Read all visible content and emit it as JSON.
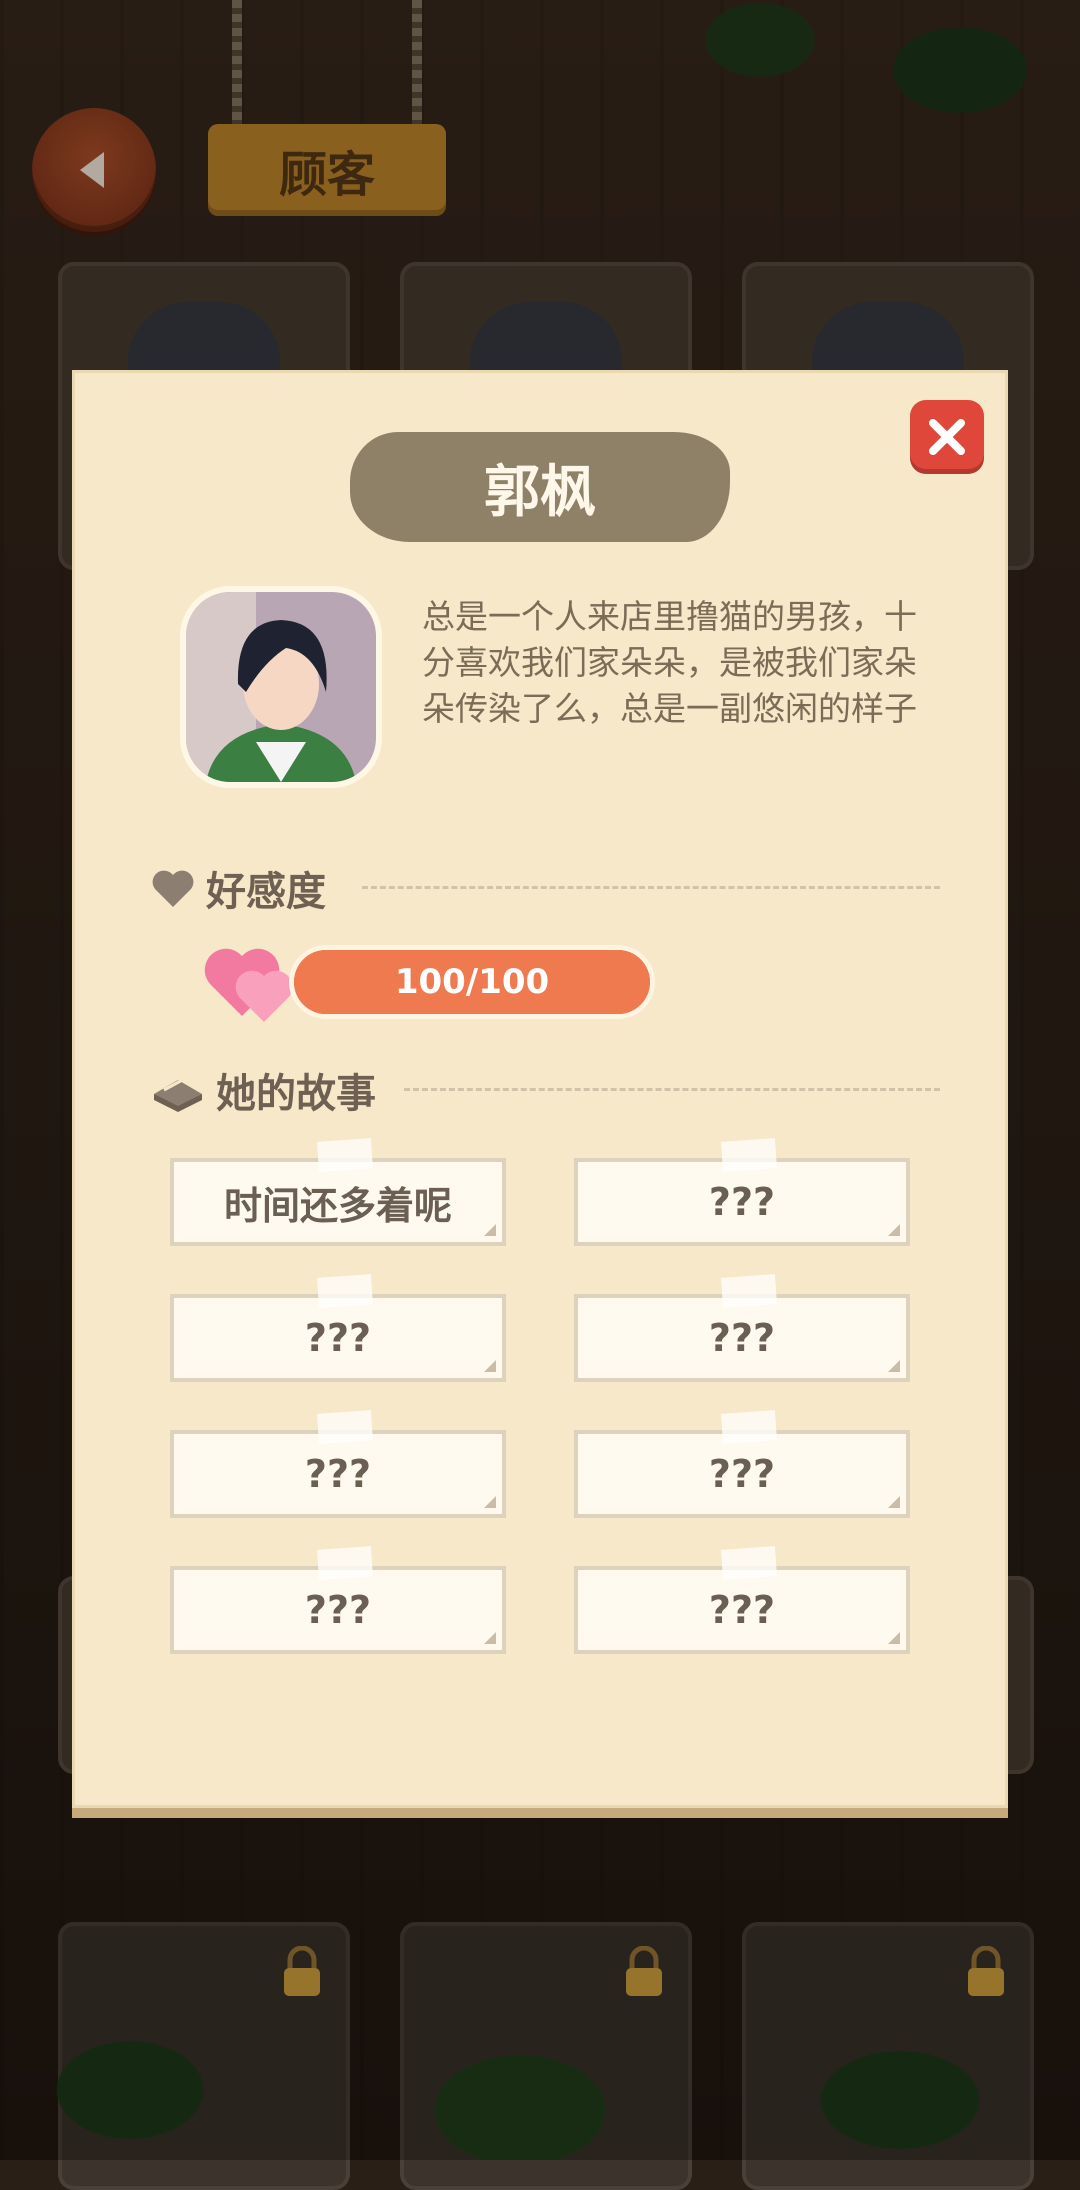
{
  "header": {
    "title": "顾客"
  },
  "modal": {
    "name": "郭枫",
    "description": "总是一个人来店里撸猫的男孩，十分喜欢我们家朵朵，是被我们家朵朵传染了么，总是一副悠闲的样子",
    "affection_label": "好感度",
    "affection_value": 100,
    "affection_max": 100,
    "affection_text": "100/100",
    "story_label": "她的故事",
    "stories": [
      {
        "title": "时间还多着呢"
      },
      {
        "title": "???"
      },
      {
        "title": "???"
      },
      {
        "title": "???"
      },
      {
        "title": "???"
      },
      {
        "title": "???"
      },
      {
        "title": "???"
      },
      {
        "title": "???"
      }
    ]
  },
  "colors": {
    "panel": "#f6e8c8",
    "close": "#e0473b",
    "affection_bar": "#f07a4f",
    "name_brush": "#8f8068"
  }
}
